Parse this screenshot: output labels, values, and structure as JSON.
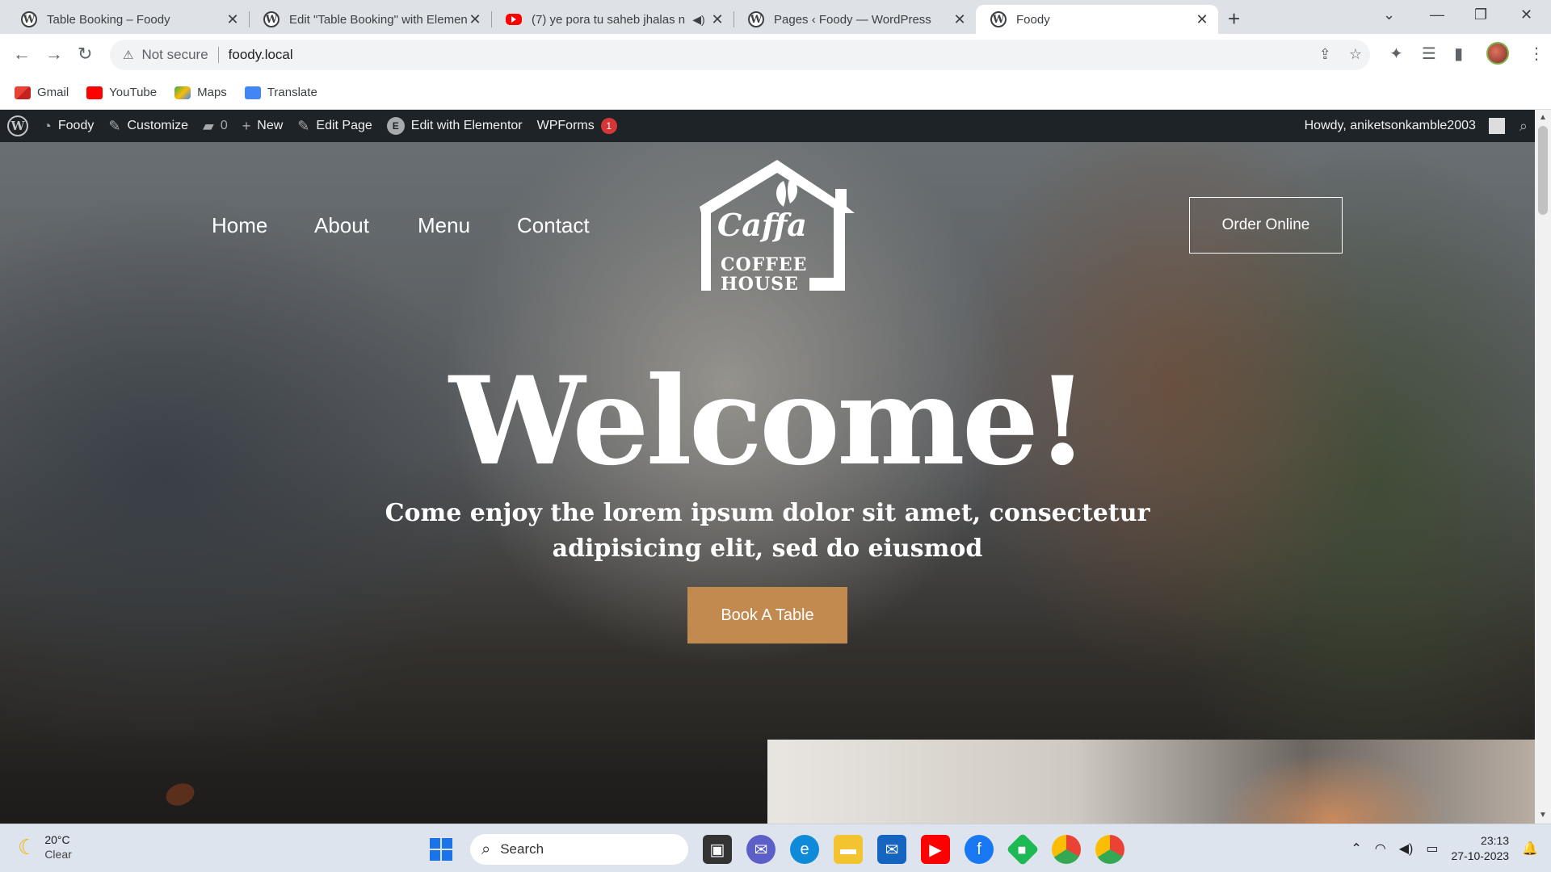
{
  "browser": {
    "tabs": [
      {
        "title": "Table Booking – Foody",
        "icon": "wordpress-icon",
        "active": false
      },
      {
        "title": "Edit \"Table Booking\" with Elemen",
        "icon": "wordpress-icon",
        "active": false
      },
      {
        "title": "(7) ye pora tu saheb jhalas n",
        "icon": "youtube-icon",
        "active": false
      },
      {
        "title": "Pages ‹ Foody — WordPress",
        "icon": "wordpress-icon",
        "active": false
      },
      {
        "title": "Foody",
        "icon": "wordpress-icon",
        "active": true
      }
    ],
    "address": {
      "security": "Not secure",
      "url": "foody.local"
    },
    "bookmarks": [
      {
        "label": "Gmail",
        "icon": "gmail-icon"
      },
      {
        "label": "YouTube",
        "icon": "youtube-icon"
      },
      {
        "label": "Maps",
        "icon": "maps-icon"
      },
      {
        "label": "Translate",
        "icon": "translate-icon"
      }
    ]
  },
  "wp_admin_bar": {
    "site_name": "Foody",
    "customize": "Customize",
    "comments_count": "0",
    "new": "New",
    "edit_page": "Edit Page",
    "edit_elementor": "Edit with Elementor",
    "wpforms": "WPForms",
    "wpforms_badge": "1",
    "howdy": "Howdy, aniketsonkamble2003"
  },
  "site": {
    "nav": [
      "Home",
      "About",
      "Menu",
      "Contact"
    ],
    "logo": {
      "script": "Caffa",
      "line1": "COFFEE",
      "line2": "HOUSE"
    },
    "order_button": "Order Online",
    "hero_title": "Welcome!",
    "hero_subtitle": "Come enjoy the lorem ipsum dolor sit amet, consectetur adipisicing elit, sed do eiusmod",
    "book_button": "Book A Table",
    "accent_color": "#c28a4f"
  },
  "taskbar": {
    "weather": {
      "temp": "20°C",
      "condition": "Clear"
    },
    "search_placeholder": "Search",
    "time": "23:13",
    "date": "27-10-2023"
  }
}
